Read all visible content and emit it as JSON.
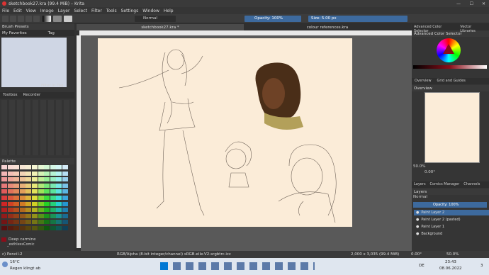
{
  "window": {
    "title": "sketchbook27.kra (99.4 MiB) – Krita",
    "min": "—",
    "max": "☐",
    "close": "✕"
  },
  "menu": [
    "File",
    "Edit",
    "View",
    "Image",
    "Layer",
    "Select",
    "Filter",
    "Tools",
    "Settings",
    "Window",
    "Help"
  ],
  "toolbar": {
    "blend_mode": "Normal",
    "opacity": "Opacity: 100%",
    "size": "Size: 5.00 px"
  },
  "left_panel": {
    "brush_presets_title": "Brush Presets",
    "favorites": "My Favorites",
    "tag": "Tag",
    "filter_in_tag": "Filter in Tag",
    "toolbox_tab": "Toolbox",
    "recorder_tab": "Recorder",
    "palette_title": "Palette",
    "color_name": "Deep carmine",
    "palette_name": "_esthlessComic",
    "tool_name": "c) Pencil-2"
  },
  "tabs": [
    {
      "label": "sketchbook27.kra *"
    },
    {
      "label": "colour references.kra"
    }
  ],
  "right_panel": {
    "top_tabs": [
      "Advanced Color Selector",
      "Vector Libraries"
    ],
    "acs_title": "Advanced Color Selector",
    "overview_tabs": [
      "Overview",
      "Grid and Guides"
    ],
    "overview_title": "Overview",
    "zoom": "50.0%",
    "rotation": "0.00°",
    "layer_tabs": [
      "Layers",
      "Comics Manager",
      "Channels"
    ],
    "layers_title": "Layers",
    "layer_blend": "Normal",
    "layer_opacity": "Opacity: 100%",
    "layers": [
      "Paint Layer 2",
      "Paint Layer 2 (pasted)",
      "Paint Layer 1",
      "Background"
    ]
  },
  "status": {
    "color_space": "RGB/Alpha (8-bit integer/channel)  sRGB-elle-V2-srgbtrc.icc",
    "dims": "2,000 x 3,035 (99.4 MiB)",
    "rotation": "0.00°",
    "zoom": "50.0%"
  },
  "taskbar": {
    "temp": "16°C",
    "weather": "Regen klingt ab",
    "lang": "DE",
    "time": "23:43",
    "date": "08.06.2022",
    "notif": "3"
  },
  "colors": {
    "accent": "#3d6a9e",
    "paper": "#fbecd8",
    "fg_color": "#8b0e1a"
  }
}
